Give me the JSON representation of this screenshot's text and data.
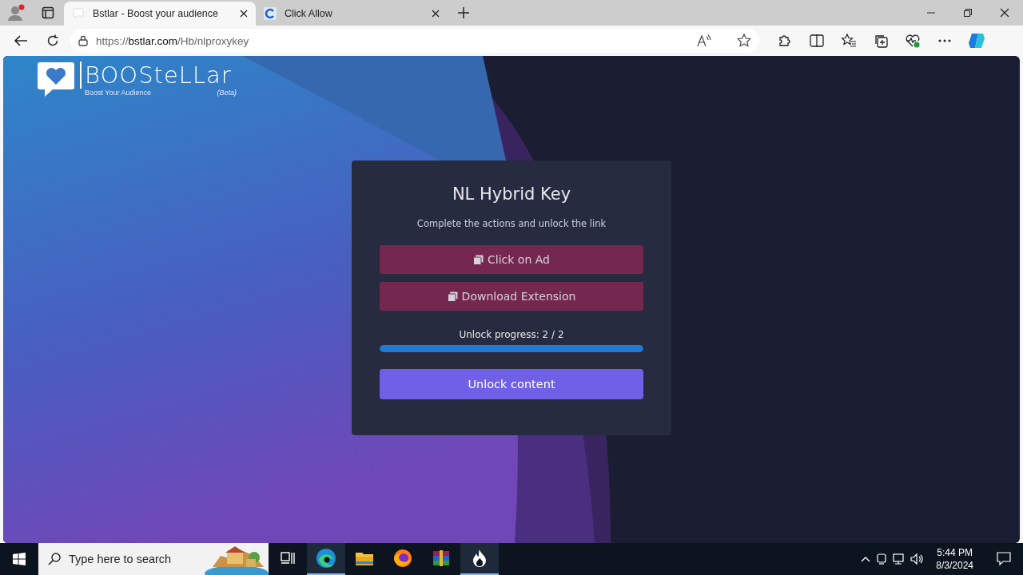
{
  "browser": {
    "tabs": [
      {
        "title": "Bstlar - Boost your audience",
        "selected": true,
        "kind": "heart"
      },
      {
        "title": "Click Allow",
        "selected": false,
        "kind": "captcha"
      }
    ],
    "address": {
      "scheme": "https://",
      "host": "bstlar.com",
      "path": "/Hb/nlproxykey"
    }
  },
  "page": {
    "logo": {
      "name": "BOOSteLLar",
      "tagline": "Boost Your Audience",
      "badge": "(Beta)"
    },
    "card": {
      "title": "NL Hybrid Key",
      "subtitle": "Complete the actions and unlock the link",
      "actions": [
        {
          "label": "Click on Ad"
        },
        {
          "label": "Download Extension"
        }
      ],
      "progress": {
        "label": "Unlock progress: 2 / 2",
        "level": 1
      },
      "submit": "Unlock content"
    }
  },
  "taskbar": {
    "search": {
      "placeholder": "Type here to search"
    },
    "apps": [
      {
        "kind": "taskview",
        "active": false
      },
      {
        "kind": "edge",
        "active": true
      },
      {
        "kind": "folder",
        "active": false
      },
      {
        "kind": "firefox",
        "active": false
      },
      {
        "kind": "archive",
        "active": false
      },
      {
        "kind": "flame",
        "active": true
      }
    ],
    "time": "5:44 PM",
    "date": "8/3/2024"
  }
}
